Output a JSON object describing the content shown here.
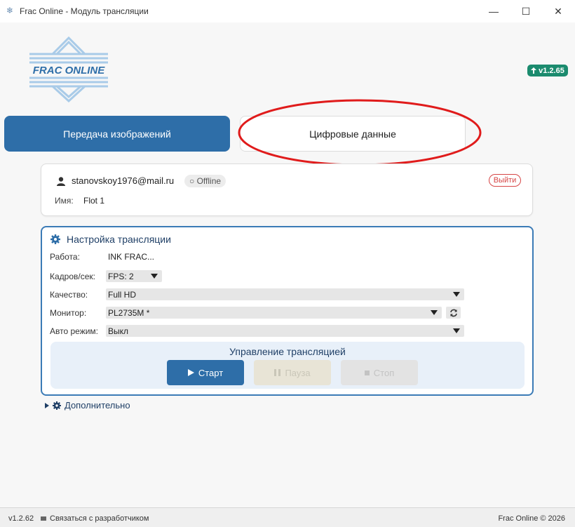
{
  "window": {
    "title": "Frac Online - Модуль трансляции",
    "controls": {
      "minimize": "—",
      "maximize": "☐",
      "close": "✕"
    }
  },
  "header": {
    "logo_text": "FRAC ONLINE",
    "version_badge": "v1.2.65"
  },
  "tabs": [
    {
      "label": "Передача изображений",
      "active": true
    },
    {
      "label": "Цифровые данные",
      "active": false
    }
  ],
  "user": {
    "email": "stanovskoy1976@mail.ru",
    "status": "○ Offline",
    "logout_label": "Выйти",
    "name_label": "Имя:",
    "name_value": "Flot 1"
  },
  "settings": {
    "title": "Настройка трансляции",
    "job_label": "Работа:",
    "job_value": "INK FRAC...",
    "fps_label": "Кадров/сек:",
    "fps_value": "FPS: 2",
    "quality_label": "Качество:",
    "quality_value": "Full HD",
    "monitor_label": "Монитор:",
    "monitor_value": "PL2735M *",
    "auto_label": "Авто режим:",
    "auto_value": "Выкл"
  },
  "control": {
    "title": "Управление трансляцией",
    "start_label": "Старт",
    "pause_label": "Пауза",
    "stop_label": "Стоп"
  },
  "additional_label": "Дополнительно",
  "footer": {
    "version": "v1.2.62",
    "contact": "Связаться с разработчиком",
    "copyright": "Frac Online © 2026"
  },
  "colors": {
    "primary": "#2e6ea8",
    "badge": "#1b8b6e",
    "danger": "#d64545",
    "annotation": "#e01b1b"
  },
  "icons": {
    "app": "snowflake-icon",
    "user": "user-icon",
    "settings": "gear-icon",
    "refresh": "refresh-icon",
    "play": "play-icon",
    "pause": "pause-icon",
    "stop": "stop-icon",
    "upload": "arrow-up-icon",
    "expand": "triangle-right-icon",
    "contact": "message-icon"
  }
}
